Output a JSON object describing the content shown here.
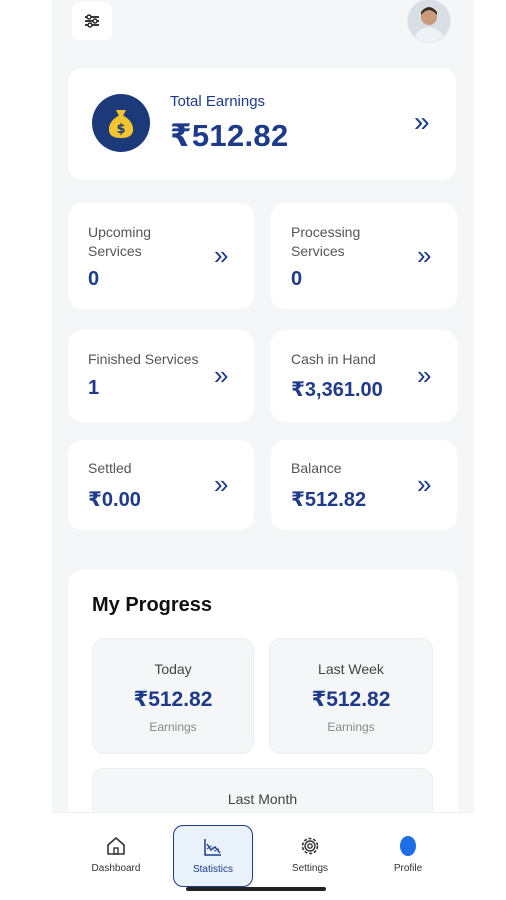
{
  "header": {
    "menu_icon": "sliders-icon",
    "avatar_icon": "user-avatar"
  },
  "total_earnings": {
    "label": "Total Earnings",
    "value": "₹512.82"
  },
  "stats": [
    {
      "label_line1": "Upcoming",
      "label_line2": "Services",
      "value": "0"
    },
    {
      "label_line1": "Processing",
      "label_line2": "Services",
      "value": "0"
    },
    {
      "label_line1": "Finished Services",
      "label_line2": "",
      "value": "1"
    },
    {
      "label_line1": "Cash in Hand",
      "label_line2": "",
      "value": "₹3,361.00"
    },
    {
      "label_line1": "Settled",
      "label_line2": "",
      "value": "₹0.00"
    },
    {
      "label_line1": "Balance",
      "label_line2": "",
      "value": "₹512.82"
    }
  ],
  "chevron": "»",
  "progress": {
    "title": "My Progress",
    "today": {
      "label": "Today",
      "value": "₹512.82",
      "sub": "Earnings"
    },
    "last_week": {
      "label": "Last Week",
      "value": "₹512.82",
      "sub": "Earnings"
    },
    "last_month": {
      "label": "Last Month"
    }
  },
  "nav": [
    {
      "label": "Dashboard",
      "icon": "home-icon"
    },
    {
      "label": "Statistics",
      "icon": "chart-icon",
      "active": true
    },
    {
      "label": "Settings",
      "icon": "gear-icon"
    },
    {
      "label": "Profile",
      "icon": "profile-icon"
    }
  ],
  "colors": {
    "accent": "#1e3a8a",
    "coin_bg": "#1c3a7a",
    "coin_gold": "#f4c430",
    "background": "#f5f6f8"
  }
}
